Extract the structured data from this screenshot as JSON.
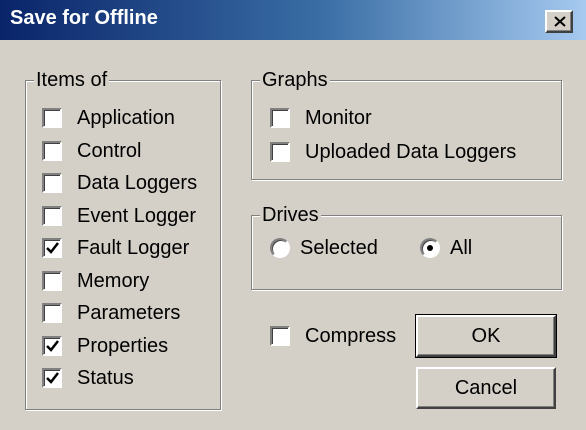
{
  "window": {
    "title": "Save for Offline",
    "close_symbol": "close-icon"
  },
  "items_group": {
    "legend": "Items of",
    "items": [
      {
        "label": "Application",
        "checked": false
      },
      {
        "label": "Control",
        "checked": false
      },
      {
        "label": "Data Loggers",
        "checked": false
      },
      {
        "label": "Event Logger",
        "checked": false
      },
      {
        "label": "Fault Logger",
        "checked": true
      },
      {
        "label": "Memory",
        "checked": false
      },
      {
        "label": "Parameters",
        "checked": false
      },
      {
        "label": "Properties",
        "checked": true
      },
      {
        "label": "Status",
        "checked": true
      }
    ]
  },
  "graphs_group": {
    "legend": "Graphs",
    "items": [
      {
        "label": "Monitor",
        "checked": false
      },
      {
        "label": "Uploaded Data Loggers",
        "checked": false
      }
    ]
  },
  "drives_group": {
    "legend": "Drives",
    "options": [
      {
        "label": "Selected",
        "selected": false
      },
      {
        "label": "All",
        "selected": true
      }
    ]
  },
  "compress": {
    "label": "Compress",
    "checked": false
  },
  "buttons": {
    "ok": "OK",
    "cancel": "Cancel"
  }
}
